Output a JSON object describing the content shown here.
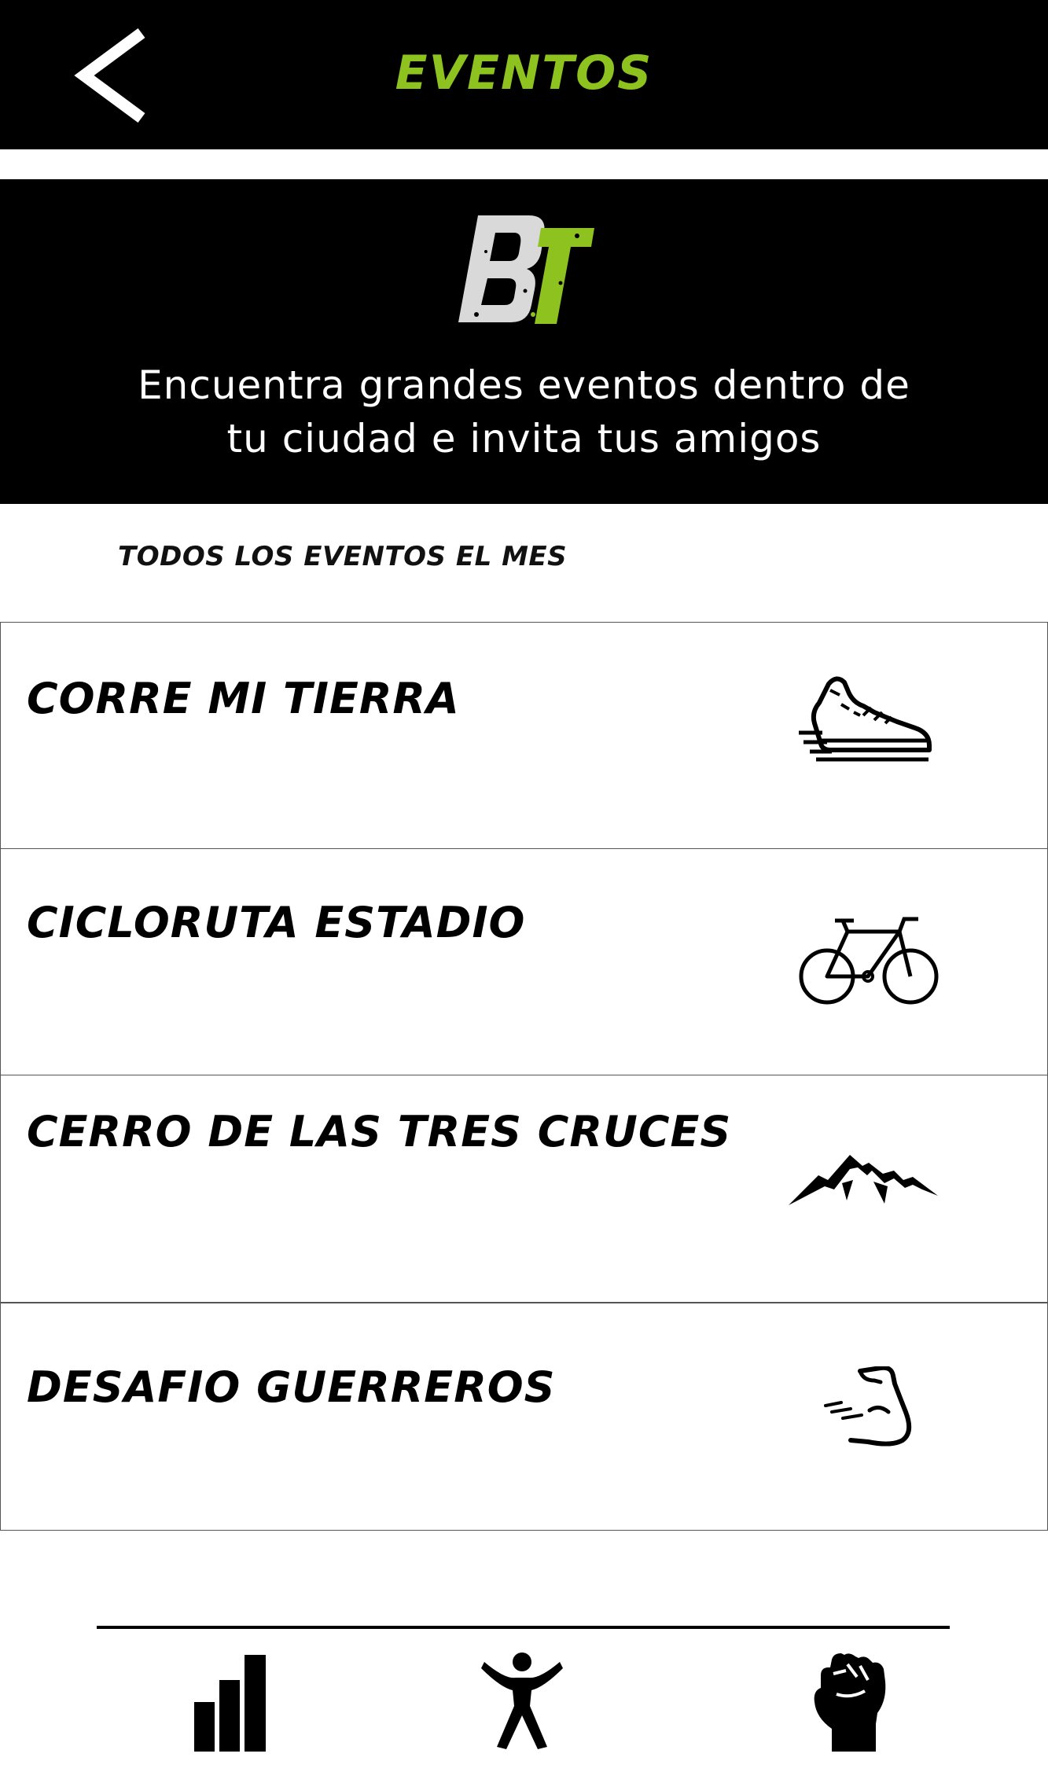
{
  "header": {
    "title": "EVENTOS",
    "back_icon": "chevron-left-icon",
    "title_color": "#8dc21f",
    "background": "#000000"
  },
  "banner": {
    "logo_text": "BT",
    "tagline_line1": "Encuentra grandes eventos dentro de",
    "tagline_line2": "tu ciudad e invita tus amigos"
  },
  "section": {
    "title": "TODOS LOS EVENTOS EL MES"
  },
  "events": [
    {
      "name": "CORRE MI TIERRA",
      "icon": "running-shoe-icon"
    },
    {
      "name": "CICLORUTA ESTADIO",
      "icon": "bicycle-icon"
    },
    {
      "name": "CERRO DE LAS TRES CRUCES",
      "icon": "mountain-icon"
    },
    {
      "name": "DESAFIO GUERREROS",
      "icon": "flexed-arm-icon"
    }
  ],
  "bottom_nav": [
    {
      "icon": "bar-chart-icon"
    },
    {
      "icon": "person-stretch-icon"
    },
    {
      "icon": "raised-fist-icon"
    }
  ]
}
